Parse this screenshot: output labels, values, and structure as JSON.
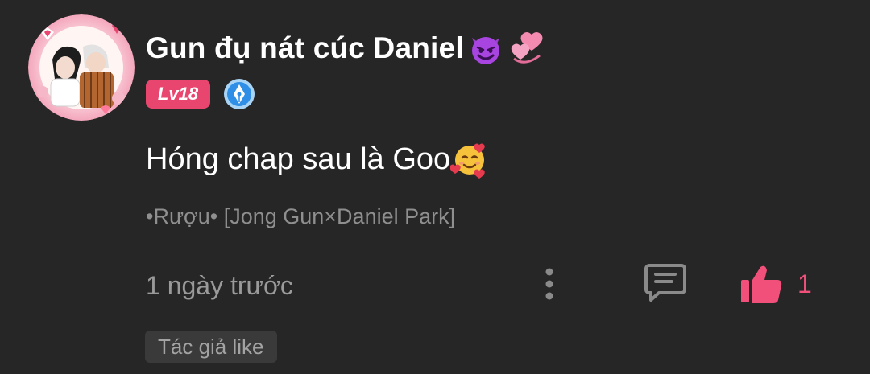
{
  "comment": {
    "username": "Gun đụ nát cúc Daniel",
    "username_emojis": [
      "smiling-devil-emoji",
      "revolving-hearts-emoji"
    ],
    "level_badge": "Lv18",
    "author_badge_icon": "pen-nib-badge-icon",
    "text": "Hóng chap sau là Goo",
    "text_emoji": "smiling-face-with-hearts-emoji",
    "series_title": "•Rượu• [Jong Gun×Daniel Park]",
    "timestamp": "1 ngày trước",
    "like_count": "1",
    "author_like_label": "Tác giả like"
  },
  "colors": {
    "background": "#262626",
    "level_badge": "#e8466f",
    "like_accent": "#f0507a",
    "secondary_text": "#9a9a9a",
    "author_like_bg": "#3a3a3a"
  }
}
